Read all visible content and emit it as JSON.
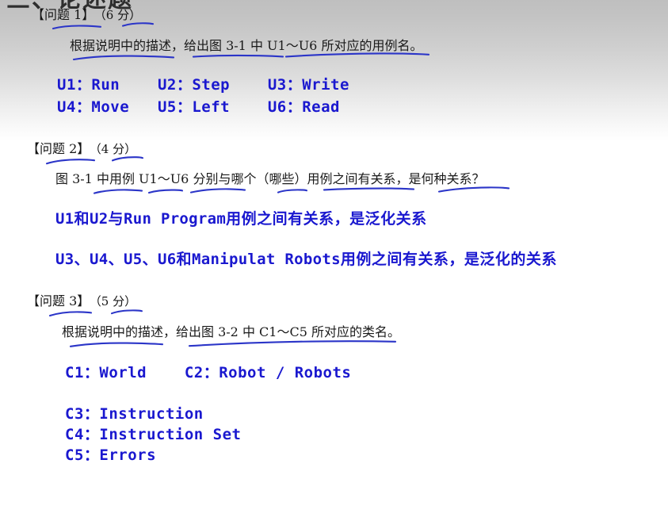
{
  "slide": {
    "cut_off_title": "三、论述题",
    "accent_blue": "#1a18cf",
    "underline_blue": "#2b35c8",
    "text_black": "#1a1a1a"
  },
  "questions": [
    {
      "header": "【问题 1】",
      "score": "（6 分）",
      "prompt": "根据说明中的描述，给出图 3-1 中 U1～U6 所对应的用例名。",
      "answers": [
        "U1：Run    U2：Step    U3：Write",
        "U4：Move   U5：Left    U6：Read"
      ]
    },
    {
      "header": "【问题 2】",
      "score": "（4 分）",
      "prompt": "图 3-1 中用例 U1～U6 分别与哪个（哪些）用例之间有关系，是何种关系？",
      "answers": [
        {
          "parts": [
            {
              "text": "U1",
              "cjk": false
            },
            {
              "text": "和",
              "cjk": true
            },
            {
              "text": "U2",
              "cjk": false
            },
            {
              "text": "与",
              "cjk": true
            },
            {
              "text": "Run Program",
              "cjk": false
            },
            {
              "text": "用例之间有关系，是泛化关系",
              "cjk": true
            }
          ]
        },
        {
          "parts": [
            {
              "text": "U3",
              "cjk": false
            },
            {
              "text": "、",
              "cjk": true
            },
            {
              "text": "U4",
              "cjk": false
            },
            {
              "text": "、",
              "cjk": true
            },
            {
              "text": "U5",
              "cjk": false
            },
            {
              "text": "、",
              "cjk": true
            },
            {
              "text": "U6",
              "cjk": false
            },
            {
              "text": "和",
              "cjk": true
            },
            {
              "text": "Manipulat Robots",
              "cjk": false
            },
            {
              "text": "用例之间有关系，是泛化的关系",
              "cjk": true
            }
          ]
        }
      ]
    },
    {
      "header": "【问题 3】",
      "score": "（5 分）",
      "prompt": "根据说明中的描述，给出图 3-2 中 C1～C5 所对应的类名。",
      "answers": [
        "C1：World    C2：Robot / Robots",
        "C3：Instruction",
        "C4：Instruction Set",
        "C5：Errors"
      ]
    }
  ]
}
